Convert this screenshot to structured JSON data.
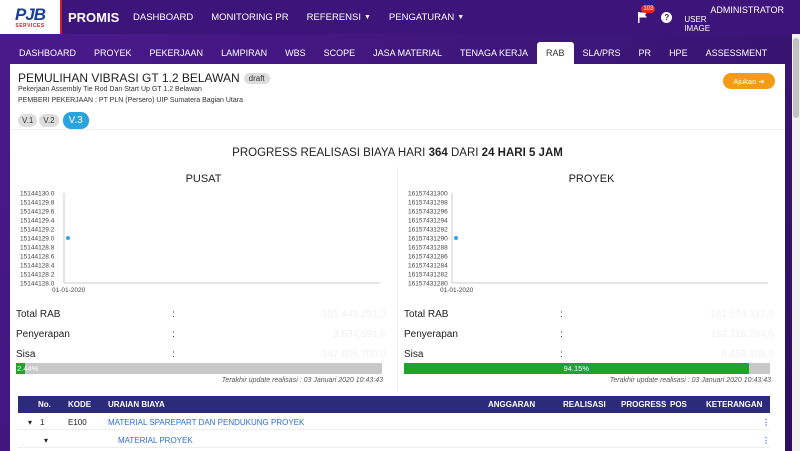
{
  "nav": {
    "logo": "PJB",
    "logo_sub": "SERVICES",
    "brand": "PROMIS",
    "items": [
      "DASHBOARD",
      "MONITORING PR",
      "REFERENSI",
      "PENGATURAN"
    ],
    "notif_count": "103",
    "user_image_alt": "USER IMAGE",
    "username": "ADMINISTRATOR"
  },
  "tabs": [
    "DASHBOARD",
    "PROYEK",
    "PEKERJAAN",
    "LAMPIRAN",
    "WBS",
    "SCOPE",
    "JASA MATERIAL",
    "TENAGA KERJA",
    "RAB",
    "SLA/PRS",
    "PR",
    "HPE",
    "ASSESSMENT"
  ],
  "active_tab": "RAB",
  "header": {
    "title": "PEMULIHAN VIBRASI GT 1.2 BELAWAN",
    "status": "draft",
    "subtitle": "Pekerjaan Assembly Tie Rod Dan Start Up GT 1.2 Belawan",
    "employer": "PEMBERI PEKERJAAN : PT PLN (Persero) UIP Sumatera Bagian Utara",
    "submit_label": "Ajukan",
    "versions": [
      "V.1",
      "V.2",
      "V.3"
    ],
    "active_version": "V.3"
  },
  "progress": {
    "prefix": "PROGRESS REALISASI BIAYA HARI",
    "day": "364",
    "mid": "DARI",
    "total": "24 HARI 5 JAM"
  },
  "pusat": {
    "title": "PUSAT",
    "total_label": "Total RAB",
    "serap_label": "Penyerapan",
    "sisa_label": "Sisa",
    "colon": ":",
    "total_value": "151.441.291,0",
    "serap_value": "3.634.591,0",
    "sisa_value": "147.806.700,0",
    "percent_label": "2.44%",
    "percent": 2.44,
    "update": "Terakhir update realisasi : 03 Januari 2020 10:43:43"
  },
  "proyek": {
    "title": "PROYEK",
    "total_label": "Total RAB",
    "serap_label": "Penyerapan",
    "sisa_label": "Sisa",
    "colon": ":",
    "total_value": "161.574.312,9",
    "serap_value": "152.116.204,0",
    "sisa_value": "9.458.108,9",
    "percent_label": "94.15%",
    "percent": 94.15,
    "update": "Terakhir update realisasi : 03 Januari 2020 10:43:43"
  },
  "chart_data": [
    {
      "type": "line",
      "title": "PUSAT",
      "x": [
        "01-01-2020"
      ],
      "series": [
        {
          "values": [
            15144129.0
          ]
        }
      ],
      "ylim": [
        15144128.0,
        15144130.0
      ],
      "yticks": [
        "15144130.0",
        "15144129.8",
        "15144129.6",
        "15144129.4",
        "15144129.2",
        "15144129.0",
        "15144128.8",
        "15144128.6",
        "15144128.4",
        "15144128.2",
        "15144128.0"
      ],
      "color": "#36a2eb"
    },
    {
      "type": "line",
      "title": "PROYEK",
      "x": [
        "01-01-2020"
      ],
      "series": [
        {
          "values": [
            16157431290.0
          ]
        }
      ],
      "ylim": [
        16157431280.0,
        16157431300.0
      ],
      "yticks": [
        "16157431300",
        "16157431298",
        "16157431296",
        "16157431294",
        "16157431292",
        "16157431290",
        "16157431288",
        "16157431286",
        "16157431284",
        "16157431282",
        "16157431280"
      ],
      "color": "#36a2eb"
    }
  ],
  "table": {
    "headers": [
      "No.",
      "KODE",
      "URAIAN BIAYA",
      "ANGGARAN",
      "REALISASI",
      "PROGRESS",
      "POS",
      "KETERANGAN"
    ],
    "rows": [
      {
        "toggle": "▾",
        "no": "1",
        "kode": "E100",
        "uraian": "MATERIAL SPAREPART DAN PENDUKUNG PROYEK",
        "menu": "⋮"
      },
      {
        "toggle": "▾",
        "no": "",
        "kode": "",
        "uraian": "MATERIAL PROYEK",
        "menu": "⋮"
      }
    ]
  }
}
